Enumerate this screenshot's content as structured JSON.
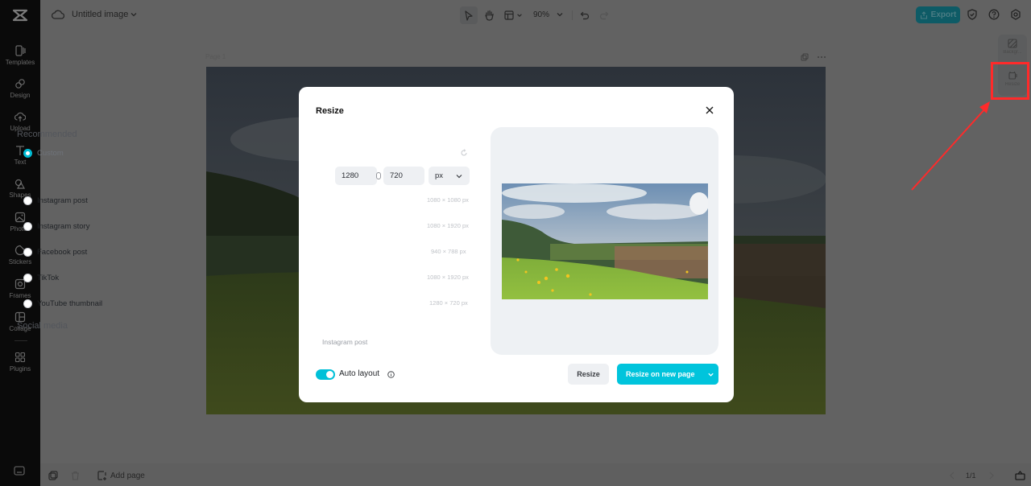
{
  "app": {
    "title": "Untitled image",
    "zoom": "90%",
    "export_label": "Export"
  },
  "sidebar": {
    "items": [
      {
        "label": "Templates",
        "icon": "templates-icon"
      },
      {
        "label": "Design",
        "icon": "design-icon"
      },
      {
        "label": "Upload",
        "icon": "upload-icon"
      },
      {
        "label": "Text",
        "icon": "text-icon"
      },
      {
        "label": "Shapes",
        "icon": "shapes-icon"
      },
      {
        "label": "Photos",
        "icon": "photos-icon"
      },
      {
        "label": "Stickers",
        "icon": "stickers-icon"
      },
      {
        "label": "Frames",
        "icon": "frames-icon"
      },
      {
        "label": "Collage",
        "icon": "collage-icon"
      },
      {
        "label": "Plugins",
        "icon": "plugins-icon"
      }
    ]
  },
  "canvas": {
    "page_label": "Page 1"
  },
  "right_panel": {
    "items": [
      {
        "label": "Backgr..."
      },
      {
        "label": "Resize"
      }
    ]
  },
  "bottom": {
    "add_page_label": "Add page",
    "pager": "1/1"
  },
  "modal": {
    "title": "Resize",
    "recommended_heading": "Recommended",
    "custom_label": "Custom",
    "width_value": "1280",
    "height_value": "720",
    "unit": "px",
    "presets": [
      {
        "label": "Instagram post",
        "dims": "1080 × 1080 px"
      },
      {
        "label": "Instagram story",
        "dims": "1080 × 1920 px"
      },
      {
        "label": "Facebook post",
        "dims": "940 × 788 px"
      },
      {
        "label": "TikTok",
        "dims": "1080 × 1920 px"
      },
      {
        "label": "YouTube thumbnail",
        "dims": "1280 × 720 px"
      }
    ],
    "social_heading": "Social media",
    "social_items": [
      "Instagram post"
    ],
    "auto_layout_label": "Auto layout",
    "auto_layout_on": true,
    "resize_button": "Resize",
    "resize_new_page_button": "Resize on new page"
  },
  "colors": {
    "accent": "#00c4dc",
    "highlight": "#ff2a2a",
    "sidebar_bg": "#0a0a0a"
  }
}
